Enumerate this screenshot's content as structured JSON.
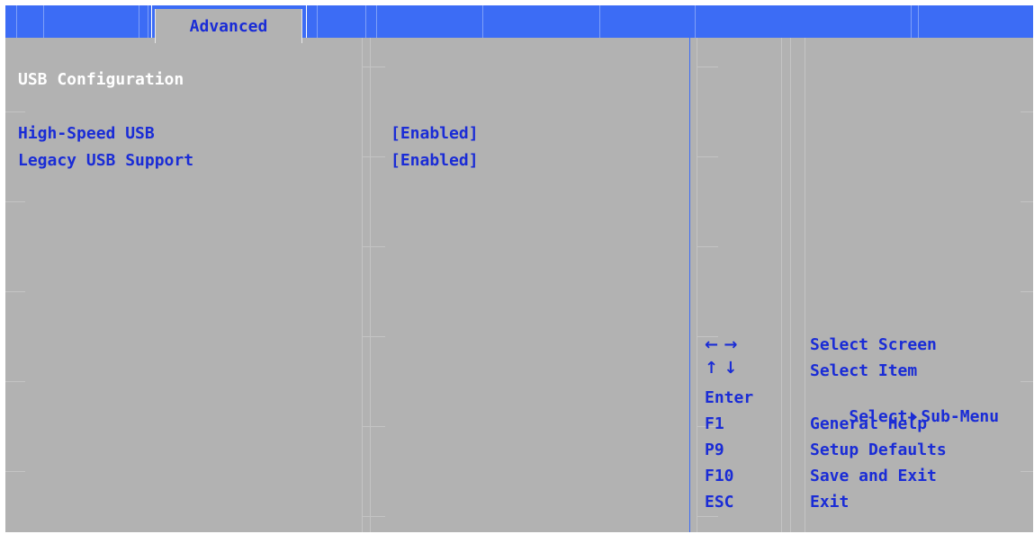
{
  "tabs": {
    "active_label": "Advanced"
  },
  "main": {
    "title": "USB Configuration",
    "items": [
      {
        "label": "High-Speed USB",
        "value": "[Enabled]"
      },
      {
        "label": "Legacy USB Support",
        "value": "[Enabled]"
      }
    ]
  },
  "help": {
    "keys": [
      {
        "key": "← →",
        "action": "Select Screen"
      },
      {
        "key": "↑ ↓",
        "action": "Select Item"
      },
      {
        "key": "Enter",
        "action_pre": "Select",
        "action_post": "Sub-Menu",
        "icon": "right-triangle-icon"
      },
      {
        "key": "F1",
        "action": "General Help"
      },
      {
        "key": "P9",
        "action": "Setup Defaults"
      },
      {
        "key": "F10",
        "action": "Save and Exit"
      },
      {
        "key": "ESC",
        "action": "Exit"
      }
    ]
  },
  "colors": {
    "accent_blue": "#3c6cf5",
    "text_blue": "#1a2cd6",
    "panel_gray": "#b2b2b2"
  }
}
